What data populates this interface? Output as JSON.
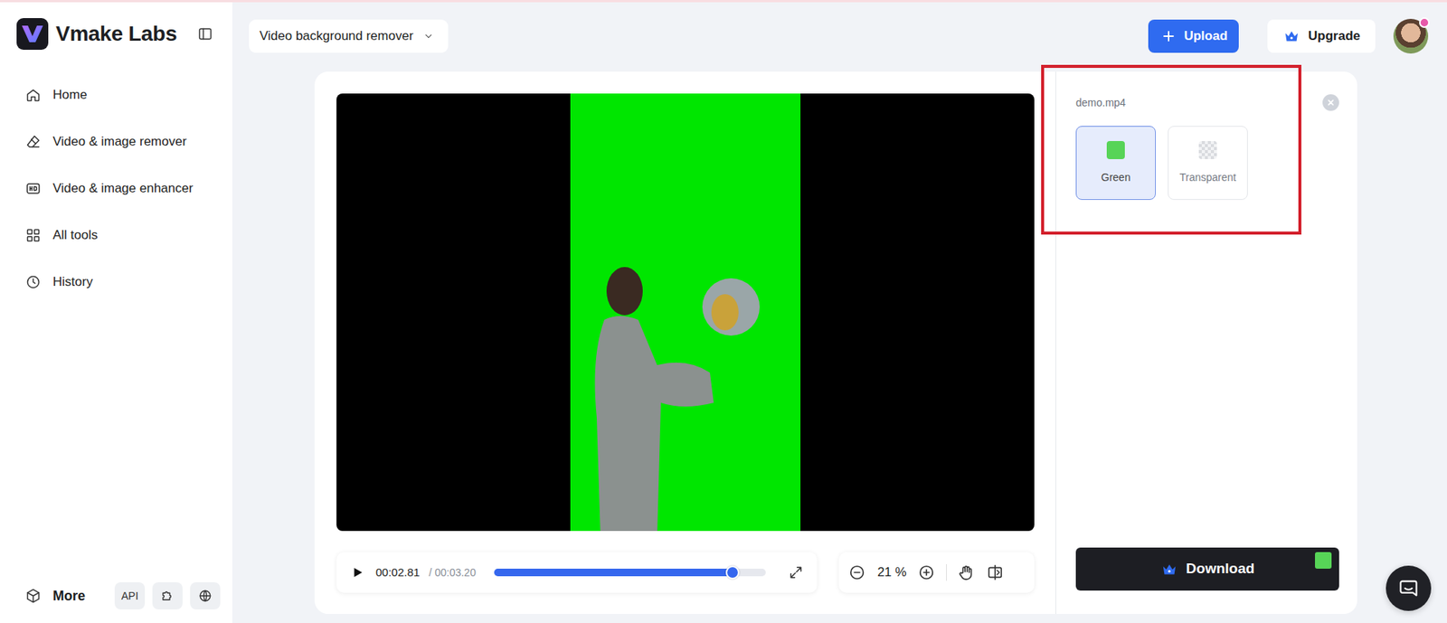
{
  "app": {
    "name": "Vmake Labs"
  },
  "sidebar": {
    "items": [
      {
        "label": "Home",
        "selected": false
      },
      {
        "label": "Video & image remover",
        "selected": false
      },
      {
        "label": "Video & image enhancer",
        "selected": false
      },
      {
        "label": "All tools",
        "selected": false
      },
      {
        "label": "History",
        "selected": false
      }
    ],
    "footer": {
      "more": "More",
      "api": "API"
    }
  },
  "toolbar": {
    "tool": "Video background remover",
    "upload": "Upload",
    "upgrade": "Upgrade"
  },
  "player": {
    "current": "00:02.81",
    "total": "/ 00:03.20",
    "level": 0.88,
    "zoom": "21 %"
  },
  "panel": {
    "file": "demo.mp4",
    "options": [
      {
        "label": "Green",
        "selected": true,
        "kind": "color"
      },
      {
        "label": "Transparent",
        "selected": false,
        "kind": "checker"
      }
    ],
    "download": "Download"
  }
}
